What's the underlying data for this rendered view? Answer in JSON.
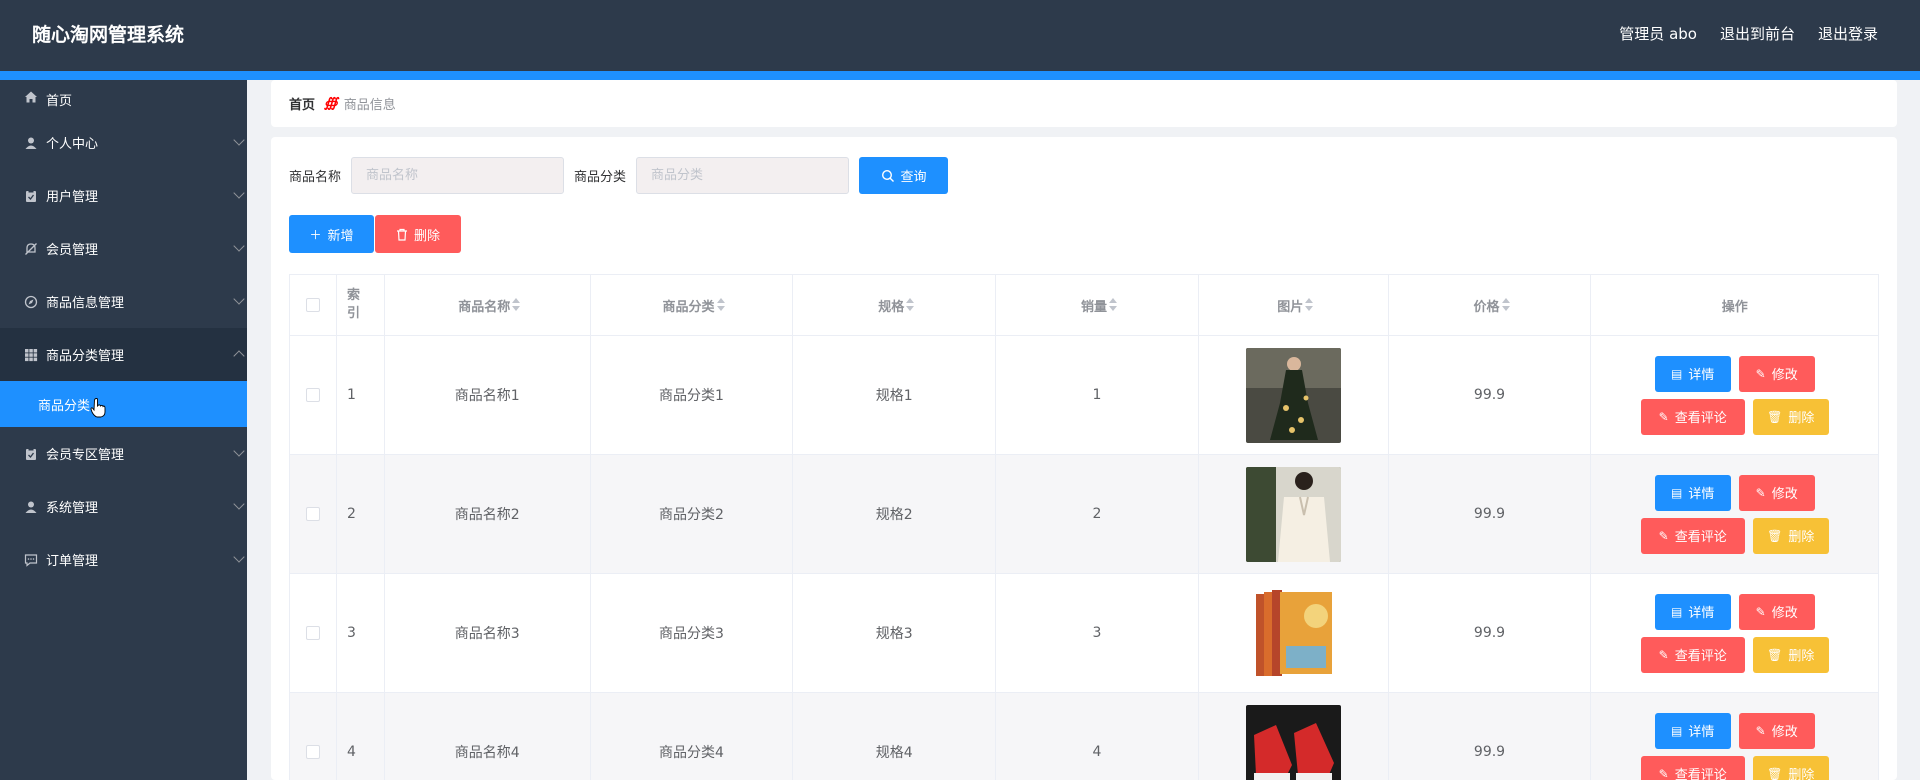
{
  "app": {
    "title": "随心淘网管理系统"
  },
  "topnav": {
    "admin": "管理员 abo",
    "front": "退出到前台",
    "logout": "退出登录"
  },
  "sidebar": {
    "items": [
      {
        "label": "首页",
        "icon": "home-icon"
      },
      {
        "label": "个人中心",
        "icon": "user-icon"
      },
      {
        "label": "用户管理",
        "icon": "clipboard-icon"
      },
      {
        "label": "会员管理",
        "icon": "bell-off-icon"
      },
      {
        "label": "商品信息管理",
        "icon": "compass-icon"
      },
      {
        "label": "商品分类管理",
        "icon": "grid-icon"
      },
      {
        "label": "会员专区管理",
        "icon": "clipboard-icon"
      },
      {
        "label": "系统管理",
        "icon": "user-icon"
      },
      {
        "label": "订单管理",
        "icon": "chat-icon"
      }
    ],
    "sub_item": "商品分类"
  },
  "breadcrumb": {
    "home": "首页",
    "separator": "∰",
    "current": "商品信息"
  },
  "search": {
    "name_label": "商品名称",
    "name_placeholder": "商品名称",
    "cat_label": "商品分类",
    "cat_placeholder": "商品分类",
    "query_button": "查询"
  },
  "actions": {
    "add": "新增",
    "delete": "删除"
  },
  "table": {
    "headers": {
      "index": "索引",
      "name": "商品名称",
      "category": "商品分类",
      "spec": "规格",
      "sales": "销量",
      "image": "图片",
      "price": "价格",
      "ops": "操作"
    },
    "rows": [
      {
        "index": "1",
        "name": "商品名称1",
        "category": "商品分类1",
        "spec": "规格1",
        "sales": "1",
        "price": "99.9"
      },
      {
        "index": "2",
        "name": "商品名称2",
        "category": "商品分类2",
        "spec": "规格2",
        "sales": "2",
        "price": "99.9"
      },
      {
        "index": "3",
        "name": "商品名称3",
        "category": "商品分类3",
        "spec": "规格3",
        "sales": "3",
        "price": "99.9"
      },
      {
        "index": "4",
        "name": "商品名称4",
        "category": "商品分类4",
        "spec": "规格4",
        "sales": "4",
        "price": "99.9"
      }
    ],
    "row_buttons": {
      "detail": "详情",
      "edit": "修改",
      "comments": "查看评论",
      "delete": "删除"
    }
  },
  "colors": {
    "topbar": "#2d3a4b",
    "accent": "#1e90ff",
    "danger": "#ff5b5b",
    "warning": "#f7c136"
  }
}
